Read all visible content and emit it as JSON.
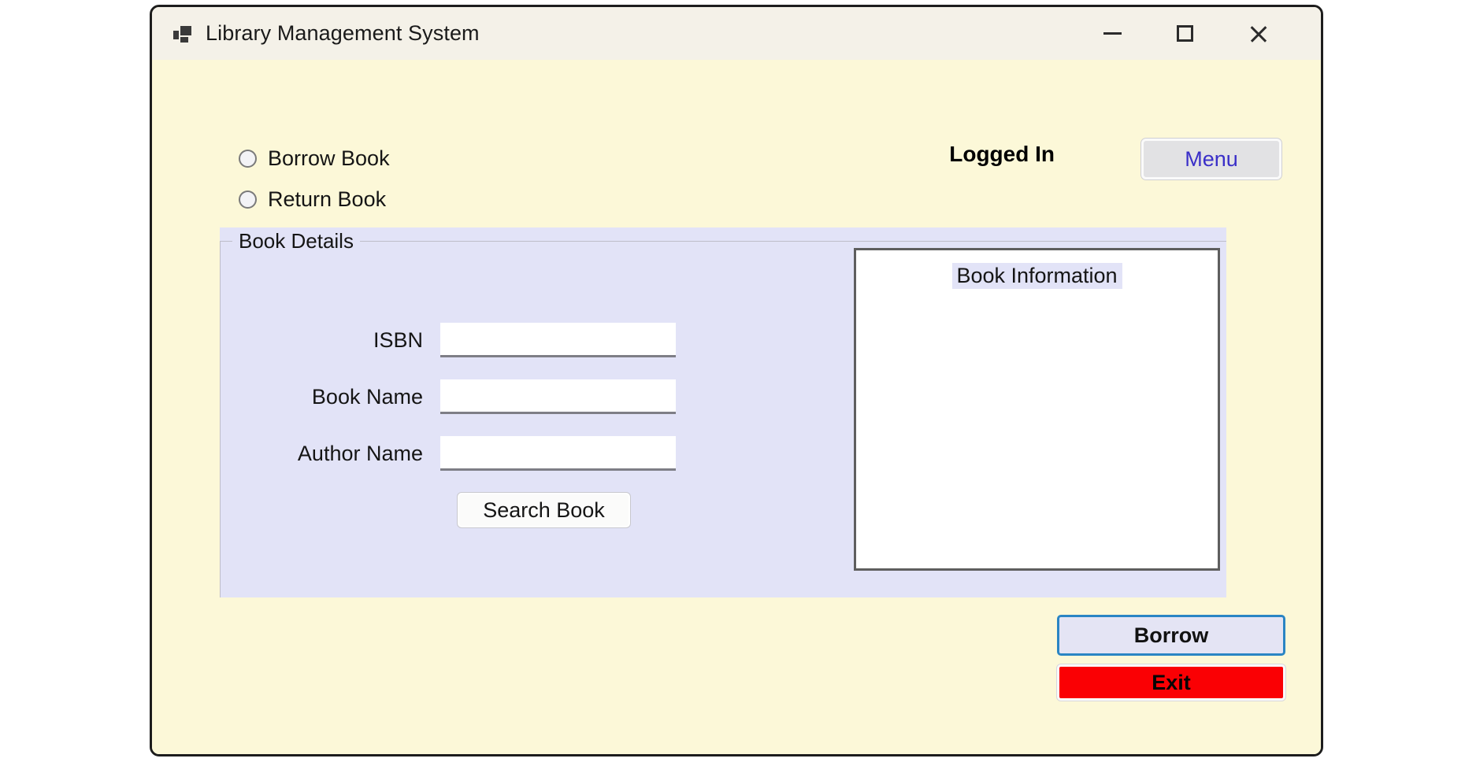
{
  "window": {
    "title": "Library Management System",
    "icon": "app-window-icon",
    "controls": {
      "minimize": "—",
      "maximize": "☐",
      "close": "✕"
    },
    "colors": {
      "body_background": "#FCF8D8",
      "titlebar_background": "#F4F1E8",
      "groupbox_background": "#E2E3F7",
      "frame_border": "#1d1d1d",
      "menu_text": "#3A2FC8",
      "exit_background": "#FA0004",
      "borrow_focus_border": "#2A85C4"
    }
  },
  "mode_options": [
    {
      "label": "Borrow Book",
      "selected": false
    },
    {
      "label": "Return Book",
      "selected": false
    }
  ],
  "session": {
    "status_label": "Logged In",
    "menu_button_label": "Menu"
  },
  "book_details": {
    "legend": "Book Details",
    "fields": [
      {
        "label": "ISBN",
        "value": "",
        "placeholder": ""
      },
      {
        "label": "Book Name",
        "value": "",
        "placeholder": ""
      },
      {
        "label": "Author Name",
        "value": "",
        "placeholder": ""
      }
    ],
    "search_button_label": "Search Book",
    "info_panel": {
      "label": "Book Information",
      "content": ""
    }
  },
  "actions": {
    "primary_label": "Borrow",
    "exit_label": "Exit"
  }
}
